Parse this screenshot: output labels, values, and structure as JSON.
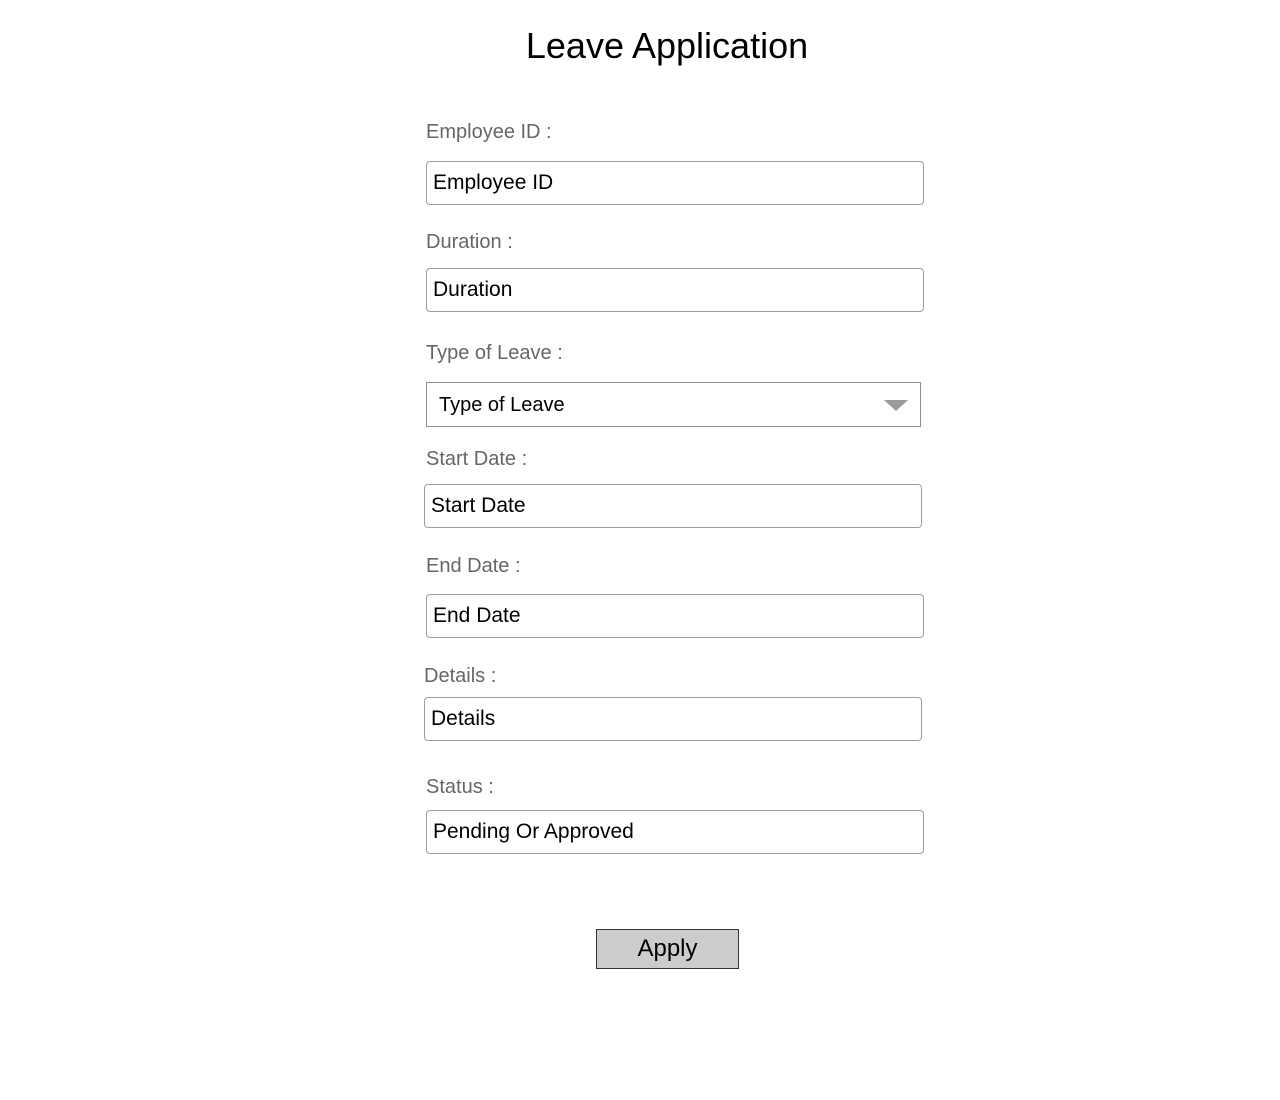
{
  "header": {
    "title": "Leave Application"
  },
  "form": {
    "employee_id": {
      "label": "Employee ID :",
      "placeholder": "Employee ID"
    },
    "duration": {
      "label": "Duration :",
      "placeholder": "Duration"
    },
    "leave_type": {
      "label": "Type of Leave :",
      "selected": "Type of Leave"
    },
    "start_date": {
      "label": "Start Date :",
      "placeholder": "Start Date"
    },
    "end_date": {
      "label": "End Date :",
      "placeholder": "End Date"
    },
    "details": {
      "label": "Details :",
      "placeholder": "Details"
    },
    "status": {
      "label": "Status :",
      "placeholder": "Pending Or Approved"
    },
    "apply_label": "Apply"
  },
  "icons": {
    "dropdown": "chevron-down-icon"
  },
  "colors": {
    "label_text": "#666666",
    "field_border": "#a09d92",
    "button_bg": "#cccccc"
  }
}
